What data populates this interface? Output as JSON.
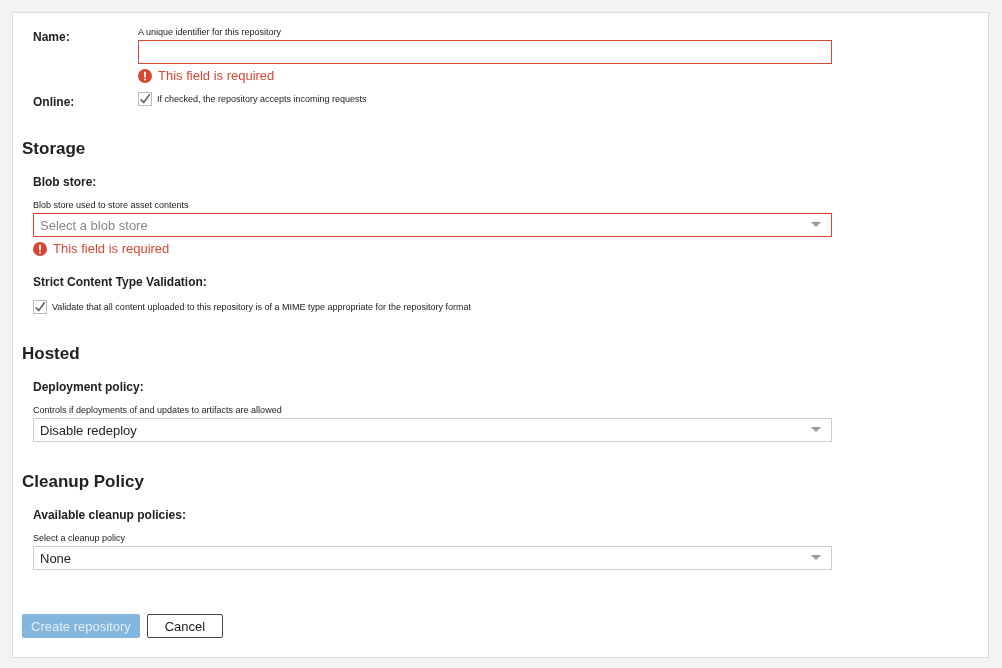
{
  "top_fields": [
    {
      "kind": "text",
      "label": "Name:",
      "hint": "A unique identifier for this repository",
      "invalid": true,
      "error": "This field is required"
    },
    {
      "kind": "checkbox",
      "label": "Online:",
      "hint": "If checked, the repository accepts incoming requests",
      "checked": true
    }
  ],
  "sections": [
    {
      "title": "Storage",
      "fields": [
        {
          "kind": "select",
          "label": "Blob store:",
          "hint": "Blob store used to store asset contents",
          "placeholder": "Select a blob store",
          "invalid": true,
          "error": "This field is required"
        },
        {
          "kind": "checkbox",
          "label": "Strict Content Type Validation:",
          "hint": "Validate that all content uploaded to this repository is of a MIME type appropriate for the repository format",
          "checked": true
        }
      ]
    },
    {
      "title": "Hosted",
      "fields": [
        {
          "kind": "select",
          "label": "Deployment policy:",
          "hint": "Controls if deployments of and updates to artifacts are allowed",
          "value": "Disable redeploy",
          "invalid": false
        }
      ]
    },
    {
      "title": "Cleanup Policy",
      "fields": [
        {
          "kind": "select",
          "label": "Available cleanup policies:",
          "hint": "Select a cleanup policy",
          "value": "None",
          "invalid": false
        }
      ]
    }
  ],
  "buttons": [
    {
      "label": "Create repository",
      "kind": "primary",
      "disabled": true
    },
    {
      "label": "Cancel",
      "kind": "default",
      "disabled": false
    }
  ]
}
